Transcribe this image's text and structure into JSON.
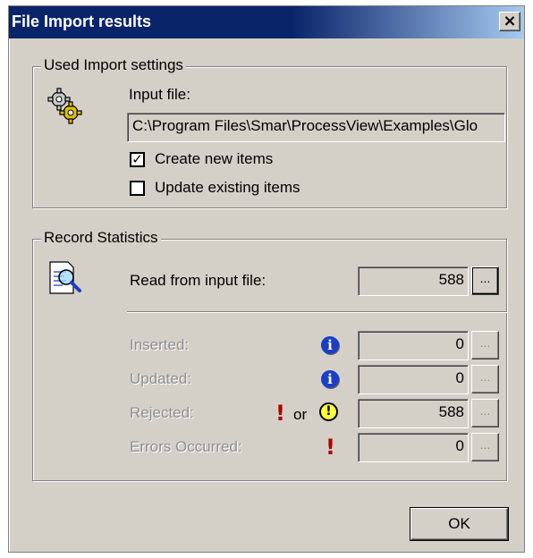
{
  "window": {
    "title": "File Import results",
    "close_label": "×"
  },
  "import_settings": {
    "legend": "Used Import settings",
    "input_file_label": "Input file:",
    "input_file_value": "C:\\Program Files\\Smar\\ProcessView\\Examples\\Glo",
    "create_new_label": "Create new items",
    "create_new_checked": true,
    "update_existing_label": "Update existing items",
    "update_existing_checked": false,
    "icon": "gears-icon"
  },
  "record_statistics": {
    "legend": "Record Statistics",
    "icon": "document-magnifier-icon",
    "read_label": "Read from input file:",
    "read_value": "588",
    "details_button_label": "...",
    "rows": [
      {
        "label": "Inserted:",
        "value": "0",
        "icon": "info-icon"
      },
      {
        "label": "Updated:",
        "value": "0",
        "icon": "info-icon"
      },
      {
        "label": "Rejected:",
        "value": "588",
        "icon": "error-or-warning-icon",
        "or_text": "or"
      },
      {
        "label": "Errors Occurred:",
        "value": "0",
        "icon": "error-icon"
      }
    ]
  },
  "ok_label": "OK",
  "colors": {
    "titlebar": "#0a246a",
    "dialog": "#d4d0c8",
    "info": "#1b3ec6",
    "error": "#b00000",
    "warning": "#ffff40"
  }
}
